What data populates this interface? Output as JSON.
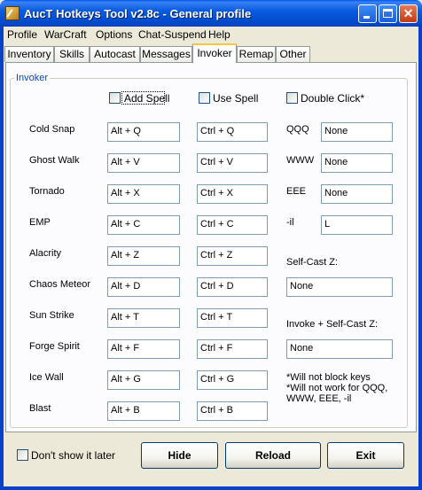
{
  "window": {
    "title": "AucT Hotkeys Tool v2.8c - General profile",
    "close_glyph": "✕"
  },
  "menu": [
    "Profile",
    "WarCraft",
    "Options",
    "Chat-Suspend",
    "Help"
  ],
  "tabs": [
    "Inventory",
    "Skills",
    "Autocast",
    "Messages",
    "Invoker",
    "Remap",
    "Other"
  ],
  "active_tab": "Invoker",
  "group": {
    "title": "Invoker",
    "add_spell": {
      "label": "Add Spell",
      "checked": false
    },
    "use_spell": {
      "label": "Use Spell",
      "checked": false
    },
    "double_click": {
      "label": "Double Click*",
      "checked": false
    }
  },
  "spells": [
    {
      "name": "Cold Snap",
      "alt": "Alt + Q",
      "ctrl": "Ctrl + Q"
    },
    {
      "name": "Ghost Walk",
      "alt": "Alt + V",
      "ctrl": "Ctrl + V"
    },
    {
      "name": "Tornado",
      "alt": "Alt + X",
      "ctrl": "Ctrl + X"
    },
    {
      "name": "EMP",
      "alt": "Alt + C",
      "ctrl": "Ctrl + C"
    },
    {
      "name": "Alacrity",
      "alt": "Alt + Z",
      "ctrl": "Ctrl + Z"
    },
    {
      "name": "Chaos Meteor",
      "alt": "Alt + D",
      "ctrl": "Ctrl + D"
    },
    {
      "name": "Sun Strike",
      "alt": "Alt + T",
      "ctrl": "Ctrl + T"
    },
    {
      "name": "Forge Spirit",
      "alt": "Alt + F",
      "ctrl": "Ctrl + F"
    },
    {
      "name": "Ice Wall",
      "alt": "Alt + G",
      "ctrl": "Ctrl + G"
    },
    {
      "name": "Blast",
      "alt": "Alt + B",
      "ctrl": "Ctrl + B"
    }
  ],
  "right": {
    "qqq": {
      "label": "QQQ",
      "value": "None"
    },
    "www": {
      "label": "WWW",
      "value": "None"
    },
    "eee": {
      "label": "EEE",
      "value": "None"
    },
    "il": {
      "label": "-il",
      "value": "L"
    },
    "self_cast": {
      "label": "Self-Cast Z:",
      "value": "None"
    },
    "invoke_self_cast": {
      "label": "Invoke + Self-Cast Z:",
      "value": "None"
    },
    "note": "*Will not block keys\n*Will not work for QQQ,\nWWW, EEE, -il"
  },
  "footer": {
    "dont_show": {
      "label": "Don't show it later",
      "checked": false
    },
    "hide": "Hide",
    "reload": "Reload",
    "exit": "Exit"
  }
}
